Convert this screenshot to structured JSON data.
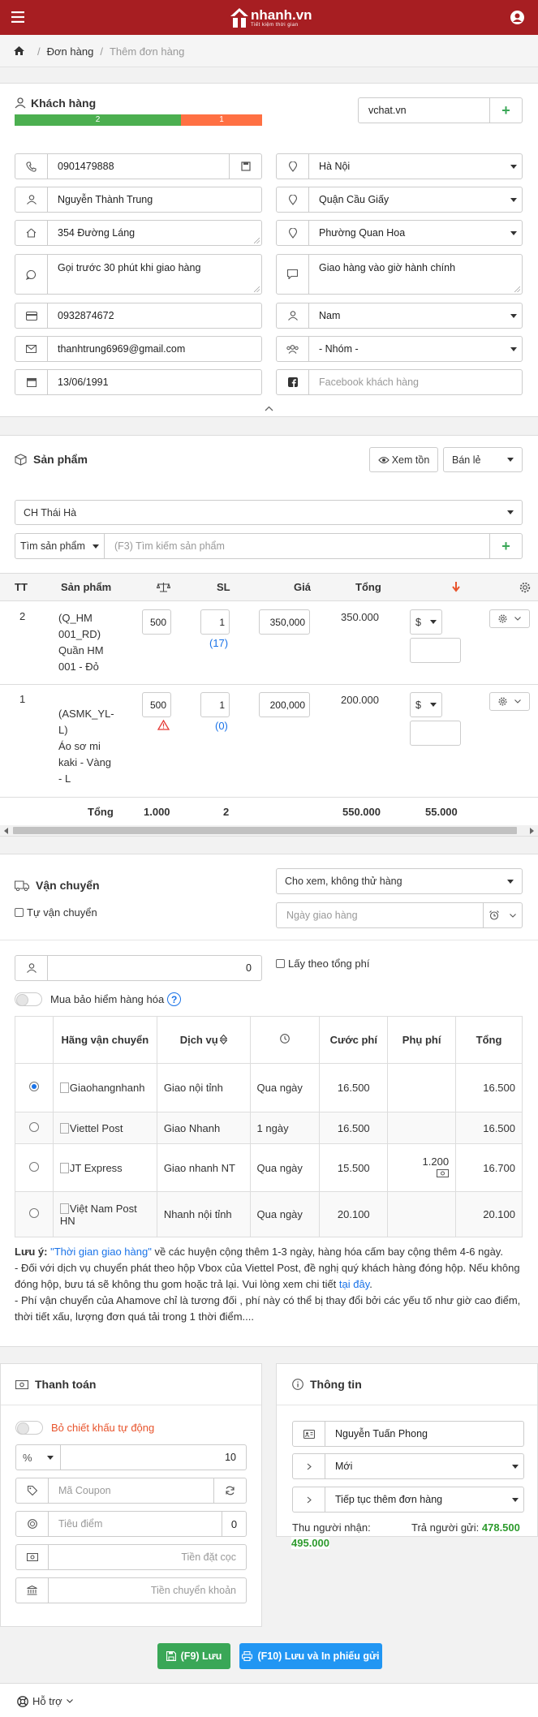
{
  "brand": {
    "logo_text": "nhanh.vn",
    "logo_tagline": "Tiết kiệm thời gian",
    "top_color": "#a71e22",
    "accent_blue": "#1a73e8",
    "accent_green": "#3aa757"
  },
  "breadcrumb": {
    "items": [
      "Đơn hàng",
      "Thêm đơn hàng"
    ]
  },
  "customer": {
    "title": "Khách hàng",
    "progress": [
      {
        "label": "2",
        "color": "#4caf50",
        "fraction": 0.67
      },
      {
        "label": "1",
        "color": "#ff7043",
        "fraction": 0.33
      }
    ],
    "store_value": "vchat.vn",
    "phone": "0901479888",
    "name": "Nguyễn Thành Trung",
    "address": "354 Đường Láng",
    "note_delivery": "Gọi trước 30 phút khi giao hàng",
    "note_time": "Giao hàng vào giờ hành chính",
    "phone2": "0932874672",
    "email": "thanhtrung6969@gmail.com",
    "dob": "13/06/1991",
    "city": "Hà Nội",
    "district": "Quận Cầu Giấy",
    "ward": "Phường Quan Hoa",
    "gender": "Nam",
    "group": "- Nhóm -",
    "facebook_placeholder": "Facebook khách hàng"
  },
  "products": {
    "title": "Sản phẩm",
    "view_stock_label": "Xem tồn",
    "price_type": "Bán lẻ",
    "store": "CH Thái Hà",
    "search_mode": "Tìm sản phẩm",
    "search_placeholder": "(F3) Tìm kiếm sản phẩm",
    "columns": {
      "tt": "TT",
      "product": "Sản phẩm",
      "qty": "SL",
      "price": "Giá",
      "total": "Tổng"
    },
    "rows": [
      {
        "tt": "2",
        "code": "(Q_HM 001_RD)",
        "name": "Quần HM 001 - Đỏ",
        "weight": "500",
        "qty": "1",
        "stock": "(17)",
        "price": "350,000",
        "total": "350.000",
        "currency": "$"
      },
      {
        "tt": "1",
        "code": "(ASMK_YL-L)",
        "name": "Áo sơ mi kaki - Vàng - L",
        "weight": "500",
        "qty": "1",
        "stock": "(0)",
        "price": "200,000",
        "total": "200.000",
        "currency": "$"
      }
    ],
    "footer": {
      "label": "Tổng",
      "weight": "1.000",
      "qty": "2",
      "total": "550.000",
      "discount": "55.000"
    }
  },
  "shipping": {
    "title": "Vận chuyển",
    "self_ship_label": "Tự vận chuyển",
    "view_option": "Cho xem, không thử hàng",
    "date_placeholder": "Ngày giao hàng",
    "weight_value": "0",
    "total_fee_label": "Lấy theo tổng phí",
    "insurance_label": "Mua bảo hiểm hàng hóa",
    "headers": [
      "Hãng vận chuyển",
      "Dịch vụ",
      "",
      "Cước phí",
      "Phụ phí",
      "Tổng"
    ],
    "carriers": [
      {
        "name": "Giaohangnhanh",
        "service": "Giao nội tỉnh",
        "time": "Qua ngày",
        "fee": "16.500",
        "extra": "",
        "total": "16.500",
        "selected": true
      },
      {
        "name": "Viettel Post",
        "service": "Giao Nhanh",
        "time": "1 ngày",
        "fee": "16.500",
        "extra": "",
        "total": "16.500",
        "selected": false
      },
      {
        "name": "JT Express",
        "service": "Giao nhanh NT",
        "time": "Qua ngày",
        "fee": "15.500",
        "extra": "1.200",
        "total": "16.700",
        "selected": false
      },
      {
        "name": "Việt Nam Post HN",
        "service": "Nhanh nội tỉnh",
        "time": "Qua ngày",
        "fee": "20.100",
        "extra": "",
        "total": "20.100",
        "selected": false
      }
    ],
    "note_label": "Lưu ý",
    "note_link": "\"Thời gian giao hàng\"",
    "note_text": " về các huyện cộng thêm 1-3 ngày, hàng hóa cấm bay cộng thêm 4-6 ngày.",
    "note2": "- Đối với dịch vụ chuyển phát theo hộp Vbox của Viettel Post, đề nghị quý khách hàng đóng hộp. Nếu không đóng hộp, bưu tá sẽ không thu gom hoặc trả lại. Vui lòng xem chi tiết ",
    "note2_link": "tại đây",
    "note3": "- Phí vận chuyển của Ahamove chỉ là tương đối , phí này có thể bị thay đổi bởi các yếu tố như giờ cao điểm, thời tiết xấu, lượng đơn quá tải trong 1 thời điểm...."
  },
  "payment": {
    "title": "Thanh toán",
    "auto_discount_label": "Bỏ chiết khấu tự động",
    "discount_unit": "%",
    "discount_value": "10",
    "coupon_placeholder": "Mã Coupon",
    "points_placeholder": "Tiêu điểm",
    "points_value": "0",
    "deposit_placeholder": "Tiền đặt cọc",
    "transfer_placeholder": "Tiền chuyển khoản"
  },
  "info": {
    "title": "Thông tin",
    "staff": "Nguyễn Tuấn Phong",
    "status": "Mới",
    "next_action": "Tiếp tục thêm đơn hàng",
    "receive_label": "Thu người nhận:",
    "receive_value": "495.000",
    "pay_label": "Trả người gửi:",
    "pay_value": "478.500"
  },
  "actions": {
    "save": "(F9) Lưu",
    "save_print": "(F10) Lưu và In phiếu gửi"
  },
  "footer": {
    "support": "Hỗ trợ"
  }
}
